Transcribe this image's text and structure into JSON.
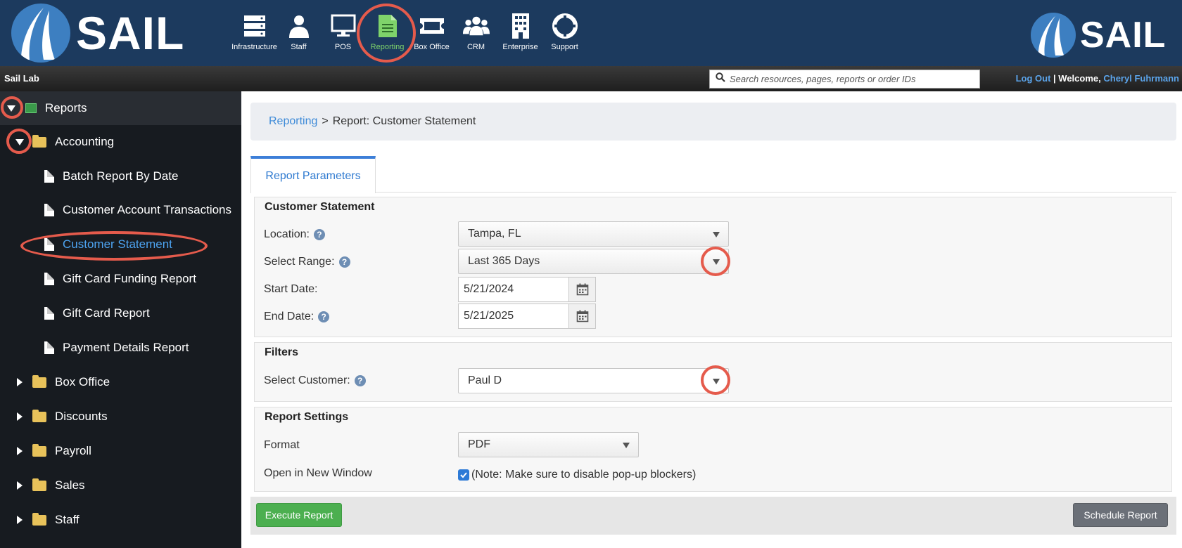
{
  "brand": {
    "name": "SAIL"
  },
  "nav": {
    "items": [
      {
        "label": "Infrastructure",
        "icon": "server-icon"
      },
      {
        "label": "Staff",
        "icon": "person-icon"
      },
      {
        "label": "POS",
        "icon": "monitor-icon"
      },
      {
        "label": "Reporting",
        "icon": "document-icon",
        "active": true
      },
      {
        "label": "Box Office",
        "icon": "ticket-icon"
      },
      {
        "label": "CRM",
        "icon": "group-icon"
      },
      {
        "label": "Enterprise",
        "icon": "building-icon"
      },
      {
        "label": "Support",
        "icon": "lifebuoy-icon"
      }
    ]
  },
  "topbar": {
    "lab_title": "Sail Lab",
    "search_placeholder": "Search resources, pages, reports or order IDs",
    "logout": "Log Out",
    "separator": "|",
    "welcome": "Welcome,",
    "user_name": "Cheryl Fuhrmann"
  },
  "sidebar": {
    "root": "Reports",
    "accounting": "Accounting",
    "accounting_items": [
      "Batch Report By Date",
      "Customer Account Transactions",
      "Customer Statement",
      "Gift Card Funding Report",
      "Gift Card Report",
      "Payment Details Report"
    ],
    "selected": "Customer Statement",
    "folders": [
      "Box Office",
      "Discounts",
      "Payroll",
      "Sales",
      "Staff"
    ]
  },
  "breadcrumb": {
    "link": "Reporting",
    "separator": ">",
    "current": "Report: Customer Statement"
  },
  "tabs": {
    "active": "Report Parameters"
  },
  "customer_statement": {
    "title": "Customer Statement",
    "location_label": "Location:",
    "location_value": "Tampa, FL",
    "range_label": "Select Range:",
    "range_value": "Last 365 Days",
    "start_label": "Start Date:",
    "start_value": "5/21/2024",
    "end_label": "End Date:",
    "end_value": "5/21/2025"
  },
  "filters": {
    "title": "Filters",
    "customer_label": "Select Customer:",
    "customer_value": "Paul D"
  },
  "settings": {
    "title": "Report Settings",
    "format_label": "Format",
    "format_value": "PDF",
    "new_window_label": "Open in New Window",
    "new_window_checked": true,
    "new_window_note": "(Note: Make sure to disable pop-up blockers)"
  },
  "buttons": {
    "execute": "Execute Report",
    "schedule": "Schedule Report"
  },
  "colors": {
    "header_bg": "#1c3a5e",
    "accent_blue": "#3d8ad8",
    "active_nav": "#7fd36b",
    "annotation_red": "#e55b4c",
    "execute_green": "#4caf50"
  }
}
